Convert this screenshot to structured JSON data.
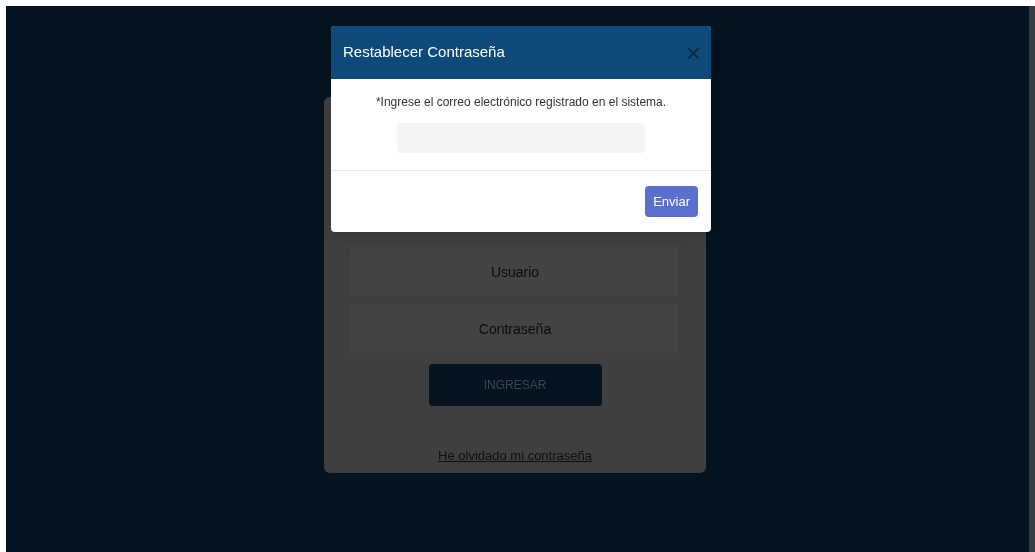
{
  "login": {
    "username": {
      "placeholder": "Usuario"
    },
    "password": {
      "placeholder": "Contraseña"
    },
    "submit": "INGRESAR",
    "forgot_link": "He olvidado mi contraseña"
  },
  "dialog": {
    "title": "Restablecer Contraseña",
    "close": "×",
    "instruction": "*Ingrese el correo electrónico registrado en el sistema.",
    "submit": "Enviar"
  }
}
